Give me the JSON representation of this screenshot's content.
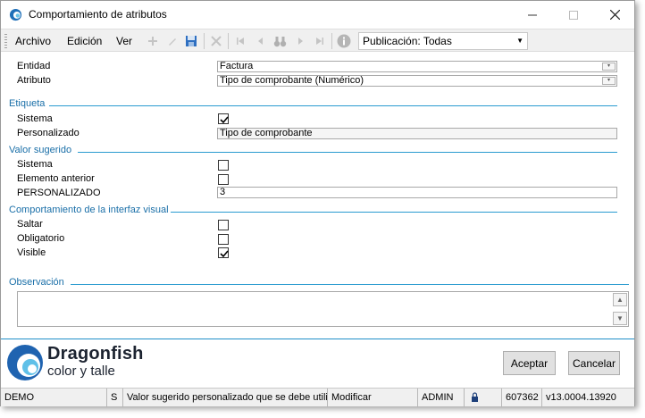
{
  "window": {
    "title": "Comportamiento de atributos"
  },
  "menu": {
    "archivo": "Archivo",
    "edicion": "Edición",
    "ver": "Ver"
  },
  "toolbar": {
    "publication_value": "Publicación: Todas"
  },
  "form": {
    "entidad_label": "Entidad",
    "entidad_value": "Factura",
    "atributo_label": "Atributo",
    "atributo_value": "Tipo de comprobante (Numérico)",
    "etiqueta": {
      "title": "Etiqueta",
      "sistema_label": "Sistema",
      "sistema_checked": true,
      "personalizado_label": "Personalizado",
      "personalizado_value": "Tipo de comprobante"
    },
    "valor_sugerido": {
      "title": "Valor sugerido",
      "sistema_label": "Sistema",
      "sistema_checked": false,
      "elemento_anterior_label": "Elemento anterior",
      "elemento_anterior_checked": false,
      "personalizado_label": "PERSONALIZADO",
      "personalizado_value": "3"
    },
    "interfaz": {
      "title": "Comportamiento de la interfaz visual",
      "saltar_label": "Saltar",
      "saltar_checked": false,
      "obligatorio_label": "Obligatorio",
      "obligatorio_checked": false,
      "visible_label": "Visible",
      "visible_checked": true
    },
    "observacion": {
      "title": "Observación",
      "value": ""
    }
  },
  "brand": {
    "name": "Dragonfish",
    "tagline": "color y talle"
  },
  "buttons": {
    "aceptar": "Aceptar",
    "cancelar": "Cancelar"
  },
  "status": {
    "env": "DEMO",
    "mode_flag": "S",
    "message": "Valor sugerido personalizado que se debe utiliz",
    "action": "Modificar",
    "user": "ADMIN",
    "number": "607362",
    "version": "v13.0004.13920"
  },
  "colors": {
    "accent": "#1f8fc8",
    "section_text": "#1a6fa8"
  }
}
